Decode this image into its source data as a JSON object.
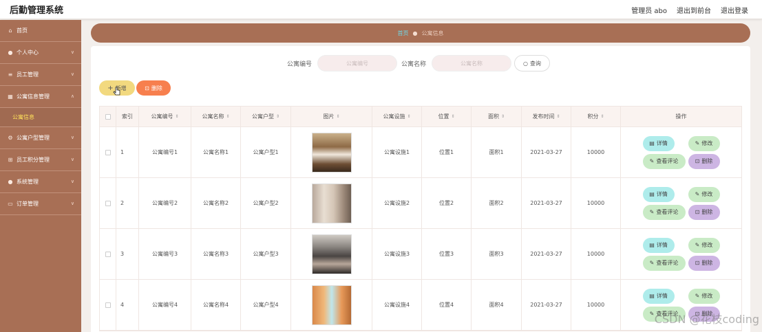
{
  "app": {
    "title": "后勤管理系统",
    "nav": [
      "管理员 abo",
      "退出到前台",
      "退出登录"
    ]
  },
  "sidebar": {
    "items": [
      {
        "label": "首页",
        "icon": "home-icon",
        "glyph": "⌂",
        "chevron": false
      },
      {
        "label": "个人中心",
        "icon": "user-icon",
        "glyph": "●",
        "chevron": true
      },
      {
        "label": "员工管理",
        "icon": "list-icon",
        "glyph": "≡",
        "chevron": true
      },
      {
        "label": "公寓信息管理",
        "icon": "building-icon",
        "glyph": "▦",
        "chevron": true,
        "sub": "公寓信息"
      },
      {
        "label": "公寓户型管理",
        "icon": "cog-icon",
        "glyph": "⚙",
        "chevron": true
      },
      {
        "label": "员工积分管理",
        "icon": "grid-icon",
        "glyph": "⊞",
        "chevron": true
      },
      {
        "label": "系统管理",
        "icon": "person-icon",
        "glyph": "●",
        "chevron": true
      },
      {
        "label": "订单管理",
        "icon": "doc-icon",
        "glyph": "▭",
        "chevron": true
      }
    ]
  },
  "breadcrumb": {
    "home": "首页",
    "current": "公寓信息"
  },
  "search": {
    "label_code": "公寓编号",
    "placeholder_code": "公寓编号",
    "label_name": "公寓名称",
    "placeholder_name": "公寓名称",
    "button": "查询"
  },
  "toolbar": {
    "add": "新增",
    "delete": "删除"
  },
  "table": {
    "headers": [
      "索引",
      "公寓编号",
      "公寓名称",
      "公寓户型",
      "图片",
      "公寓设施",
      "位置",
      "面积",
      "发布时间",
      "积分",
      "操作"
    ],
    "rows": [
      {
        "index": "1",
        "code": "公寓编号1",
        "name": "公寓名称1",
        "type": "公寓户型1",
        "facility": "公寓设施1",
        "location": "位置1",
        "area": "面积1",
        "date": "2021-03-27",
        "points": "10000",
        "img": "bedroom-warm"
      },
      {
        "index": "2",
        "code": "公寓编号2",
        "name": "公寓名称2",
        "type": "公寓户型2",
        "facility": "公寓设施2",
        "location": "位置2",
        "area": "面积2",
        "date": "2021-03-27",
        "points": "10000",
        "img": "livingroom-cream"
      },
      {
        "index": "3",
        "code": "公寓编号3",
        "name": "公寓名称3",
        "type": "公寓户型3",
        "facility": "公寓设施3",
        "location": "位置3",
        "area": "面积3",
        "date": "2021-03-27",
        "points": "10000",
        "img": "livingroom-dark"
      },
      {
        "index": "4",
        "code": "公寓编号4",
        "name": "公寓名称4",
        "type": "公寓户型4",
        "facility": "公寓设施4",
        "location": "位置4",
        "area": "面积4",
        "date": "2021-03-27",
        "points": "10000",
        "img": "hallway-orange"
      }
    ],
    "actions": {
      "detail": "详情",
      "edit": "修改",
      "review": "查看评论",
      "remove": "删除"
    }
  },
  "watermark": "CSDN @花枝coding",
  "colors": {
    "sidebar": "#a86f55",
    "accent_yellow": "#ffe15a",
    "add": "#f2d97f",
    "delete": "#f77f4e",
    "detail": "#aeeceb",
    "edit": "#c9ebc6",
    "remove": "#cdb5e3"
  }
}
